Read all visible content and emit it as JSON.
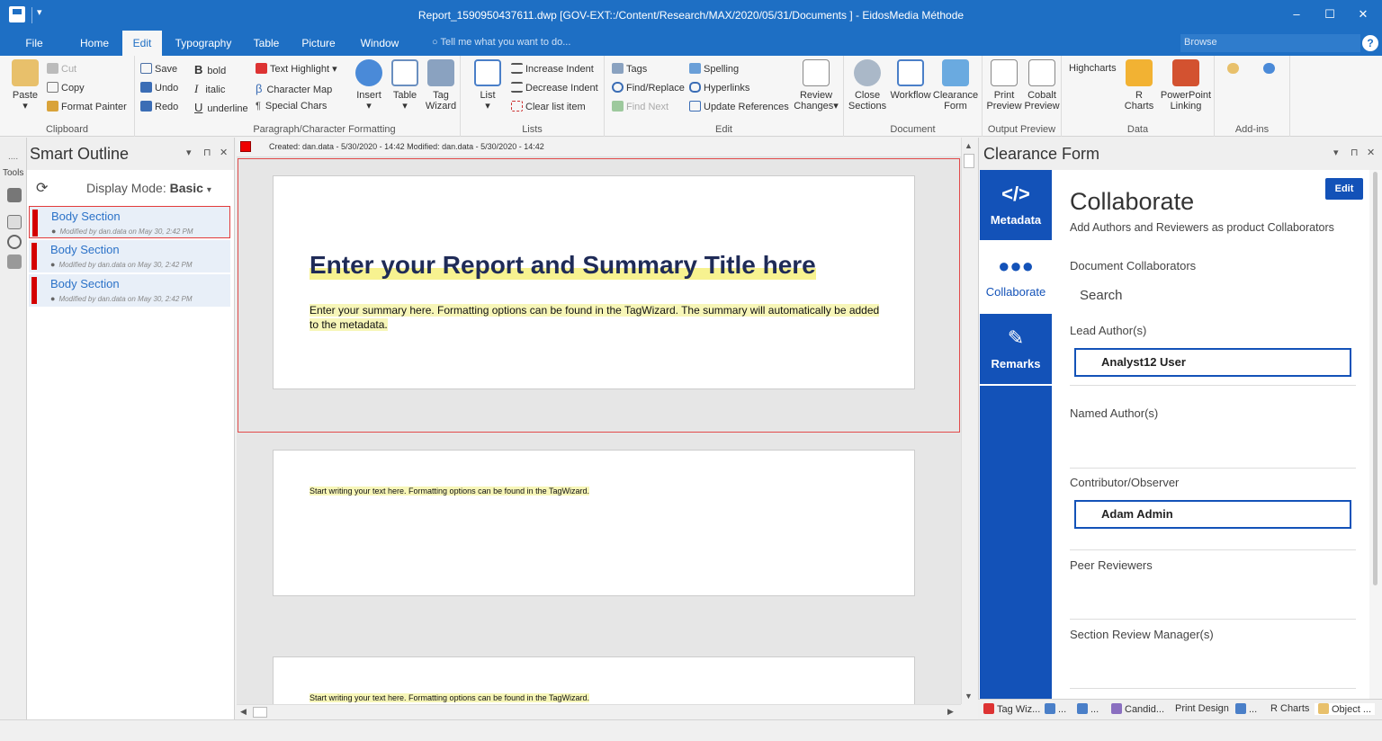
{
  "window": {
    "title": "Report_1590950437611.dwp  [GOV-EXT::/Content/Research/MAX/2020/05/31/Documents ] - EidosMedia Méthode",
    "quick_access": "▾",
    "minimize": "–",
    "maximize": "☐",
    "close": "✕"
  },
  "ribbon_tabs": {
    "file": "File",
    "home": "Home",
    "edit": "Edit",
    "typography": "Typography",
    "table": "Table",
    "picture": "Picture",
    "window": "Window",
    "tell_me": "Tell me what you want to do...",
    "browse": "Browse",
    "help": "?"
  },
  "clipboard": {
    "paste": "Paste",
    "cut": "Cut",
    "copy": "Copy",
    "format_painter": "Format Painter",
    "label": "Clipboard"
  },
  "save_group": {
    "save": "Save",
    "undo": "Undo",
    "redo": "Redo"
  },
  "formatting": {
    "bold": "bold",
    "italic": "italic",
    "underline": "underline",
    "text_highlight": "Text Highlight",
    "character_map": "Character Map",
    "special_chars": "Special Chars",
    "insert": "Insert",
    "table": "Table",
    "tag_wizard_1": "Tag",
    "tag_wizard_2": "Wizard",
    "label": "Paragraph/Character Formatting"
  },
  "lists": {
    "list": "List",
    "increase_indent": "Increase Indent",
    "decrease_indent": "Decrease Indent",
    "clear_list_item": "Clear list item",
    "label": "Lists"
  },
  "edit_group": {
    "tags": "Tags",
    "find_replace": "Find/Replace",
    "find_next": "Find Next",
    "spelling": "Spelling",
    "hyperlinks": "Hyperlinks",
    "update_references": "Update References",
    "review_1": "Review",
    "review_2": "Changes",
    "label": "Edit"
  },
  "document_group": {
    "close_1": "Close",
    "close_2": "Sections",
    "workflow": "Workflow",
    "clearance_1": "Clearance",
    "clearance_2": "Form",
    "label": "Document"
  },
  "output_group": {
    "print_1": "Print",
    "print_2": "Preview",
    "cobalt_1": "Cobalt",
    "cobalt_2": "Preview",
    "label": "Output Preview"
  },
  "data_group": {
    "highcharts": "Highcharts",
    "r_1": "R",
    "r_2": "Charts",
    "ppt_1": "PowerPoint",
    "ppt_2": "Linking",
    "label": "Data"
  },
  "addins_group": {
    "label": "Add-ins"
  },
  "tools": {
    "label": "Tools",
    "dots": "...."
  },
  "smart_outline": {
    "title": "Smart Outline",
    "dropdown": "▾",
    "pin": "⊓",
    "close": "✕",
    "refresh": "⟳",
    "mode_prefix": "Display Mode: ",
    "mode_value": "Basic",
    "mode_caret": "▾",
    "sections": [
      {
        "title": "Body Section",
        "meta": "Modified by dan.data on May 30, 2:42 PM"
      },
      {
        "title": "Body Section",
        "meta": "Modified by dan.data on May 30, 2:42 PM"
      },
      {
        "title": "Body Section",
        "meta": "Modified by dan.data on May 30, 2:42 PM"
      }
    ]
  },
  "document": {
    "info": "Created: dan.data - 5/30/2020 - 14:42   Modified: dan.data - 5/30/2020 - 14:42",
    "title": "Enter your Report and Summary Title here",
    "summary": "Enter your summary here. Formatting options can be found in the TagWizard. The summary will automatically be added to the metadata.",
    "body_1": "Start writing your text here. Formatting options can be found in the TagWizard.",
    "body_2": "Start writing your text here. Formatting options can be found in the TagWizard."
  },
  "clearance_form": {
    "title": "Clearance Form",
    "dropdown": "▾",
    "pin": "⊓",
    "close": "✕",
    "nav": {
      "metadata": "Metadata",
      "collaborate": "Collaborate",
      "remarks": "Remarks"
    },
    "heading": "Collaborate",
    "subheading": "Add Authors and Reviewers as product Collaborators",
    "edit": "Edit",
    "document_collaborators": "Document Collaborators",
    "search": "Search",
    "lead_author_label": "Lead Author(s)",
    "lead_author_value": "Analyst12 User",
    "named_author_label": "Named Author(s)",
    "contributor_label": "Contributor/Observer",
    "contributor_value": "Adam Admin",
    "peer_reviewers_label": "Peer Reviewers",
    "section_review_label": "Section Review Manager(s)"
  },
  "panel_tabs": {
    "tag_wizard": "Tag Wiz...",
    "t2": "...",
    "t3": "...",
    "candid": "Candid...",
    "print_design": "Print Design",
    "t6": "...",
    "r_charts": "R Charts",
    "object": "Object ..."
  },
  "colors": {
    "brand": "#1e6fc4",
    "nav_blue": "#1352b8",
    "section_red": "#d40000"
  }
}
